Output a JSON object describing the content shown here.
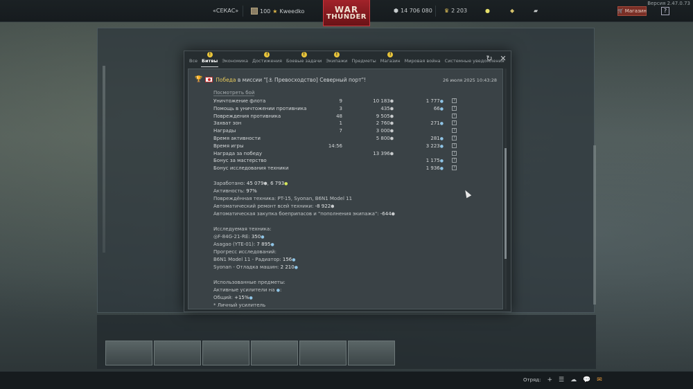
{
  "topbar": {
    "version": "Версия 2.47.0.73",
    "clan_tag": "«СЕКАС»",
    "level": "100",
    "nickname": "Kweedko",
    "logo_line1": "WAR",
    "logo_line2": "THUNDER",
    "silver_lions": "14 706 080",
    "golden_eagles": "2 203",
    "shop_label": "Магазин",
    "help_label": "?"
  },
  "modal": {
    "tabs": [
      {
        "label": "Все",
        "badge": ""
      },
      {
        "label": "Битвы",
        "badge": "!"
      },
      {
        "label": "Экономика",
        "badge": ""
      },
      {
        "label": "Достижения",
        "badge": "!"
      },
      {
        "label": "Боевые задачи",
        "badge": "!"
      },
      {
        "label": "Экипажи",
        "badge": "!"
      },
      {
        "label": "Предметы",
        "badge": ""
      },
      {
        "label": "Магазин",
        "badge": "!"
      },
      {
        "label": "Мировая война",
        "badge": ""
      },
      {
        "label": "Системные уведомления",
        "badge": ""
      }
    ],
    "active_tab": "Битвы",
    "message": {
      "result": "Победа",
      "mission_text": " в миссии \"[⚓ Превосходство] Северный порт\"!",
      "date": "26 июля 2025 10:43:28",
      "watch_link": "Посмотреть бой",
      "rows": [
        {
          "name": "Уничтожение флота",
          "count": "9",
          "sl": "10 183",
          "rp": "1 777"
        },
        {
          "name": "Помощь в уничтожении противника",
          "count": "3",
          "sl": "435",
          "rp": "66"
        },
        {
          "name": "Повреждения противника",
          "count": "48",
          "sl": "9 505",
          "rp": ""
        },
        {
          "name": "Захват зон",
          "count": "1",
          "sl": "2 760",
          "rp": "271"
        },
        {
          "name": "Награды",
          "count": "7",
          "sl": "3 000",
          "rp": ""
        },
        {
          "name": "Время активности",
          "count": "",
          "sl": "5 800",
          "rp": "281"
        },
        {
          "name": "Время игры",
          "count": "14:56",
          "sl": "",
          "rp": "3 223"
        },
        {
          "name": "Награда за победу",
          "count": "",
          "sl": "13 396",
          "rp": ""
        },
        {
          "name": "Бонус за мастерство",
          "count": "",
          "sl": "",
          "rp": "1 175"
        },
        {
          "name": "Бонус исследования техники",
          "count": "",
          "sl": "",
          "rp": "1 936"
        }
      ],
      "earned_label": "Заработано: ",
      "earned_sl": "45 079",
      "earned_rp": "6 793",
      "activity_label": "Активность: ",
      "activity_value": "97%",
      "damaged_vehicles": "Повреждённая техника: PT-15, Syonan, B6N1 Model 11",
      "repair_label": "Автоматический ремонт всей техники: ",
      "repair_value": "-8 922",
      "ammo_label": "Автоматическая закупка боеприпасов и \"пополнения экипажа\": ",
      "ammo_value": "-644",
      "research_title": "Исследуемая техника:",
      "research_1_name": "F-84G-21-RE: ",
      "research_1_value": "350",
      "research_2_name": "Asagao (YTE-01): ",
      "research_2_value": "7 895",
      "progress_title": "Прогресс исследований:",
      "progress_1_name": "B6N1 Model 11 - Радиатор: ",
      "progress_1_value": "156",
      "progress_2_name": "Syonan - Отладка машин: ",
      "progress_2_value": "2 210",
      "items_title": "Использованные предметы:",
      "boosters_label": "Активные усилители на ",
      "common_label": "Общий: ",
      "common_value": "+15%",
      "personal_label": "* Личный усилитель"
    }
  },
  "bottombar": {
    "squad_label": "Отряд:"
  }
}
